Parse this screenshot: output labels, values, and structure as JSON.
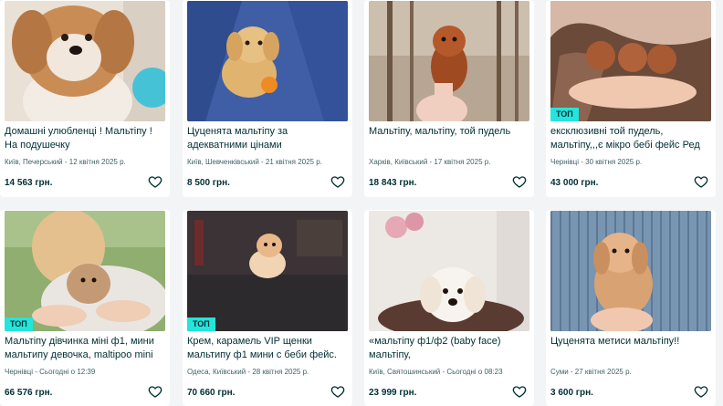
{
  "accent_colors": {
    "top_badge": "#23e5db",
    "text": "#002f34",
    "meta": "#406367"
  },
  "listings": [
    {
      "title": "Домашні улюбленці ! Мальтіпу ! На подушечку",
      "location_date": "Київ, Печерський - 12 квітня 2025 р.",
      "price": "14 563 грн.",
      "top": false,
      "favorite_icon": "heart-outline-icon"
    },
    {
      "title": "Цуценята мальтіпу за адекватними цінами",
      "location_date": "Київ, Шевченківський - 21 квітня 2025 р.",
      "price": "8 500 грн.",
      "top": false,
      "favorite_icon": "heart-outline-icon"
    },
    {
      "title": "Мальтіпу, мальтіпу, той пудель",
      "location_date": "Харків, Київський - 17 квітня 2025 р.",
      "price": "18 843 грн.",
      "top": false,
      "favorite_icon": "heart-outline-icon"
    },
    {
      "title": "ексклюзивні той пудель, мальтіпу,,,є мікро бебі фейс Ред Браун",
      "location_date": "Чернівці - 30 квітня 2025 р.",
      "price": "43 000 грн.",
      "top": true,
      "badge": "ТОП",
      "favorite_icon": "heart-outline-icon"
    },
    {
      "title": "Мальтіпу дівчинка міні ф1, мини мальтипу девочка, maltipoo mini f1,",
      "location_date": "Чернівці - Сьогодні о 12:39",
      "price": "66 576 грн.",
      "top": true,
      "badge": "ТОП",
      "favorite_icon": "heart-outline-icon"
    },
    {
      "title": "Крем, карамель VIP щенки мальтипу ф1 мини с беби фейс.",
      "location_date": "Одеса, Київський - 28 квітня 2025 р.",
      "price": "70 660 грн.",
      "top": true,
      "badge": "ТОП",
      "favorite_icon": "heart-outline-icon"
    },
    {
      "title": "«мальтіпу ф1/ф2 (baby face) мальтіпу,",
      "location_date": "Київ, Святошинський - Сьогодні о 08:23",
      "price": "23 999 грн.",
      "top": false,
      "favorite_icon": "heart-outline-icon"
    },
    {
      "title": "Цуценята метиси мальтіпу!!",
      "location_date": "Суми - 27 квітня 2025 р.",
      "price": "3 600 грн.",
      "top": false,
      "favorite_icon": "heart-outline-icon"
    }
  ]
}
